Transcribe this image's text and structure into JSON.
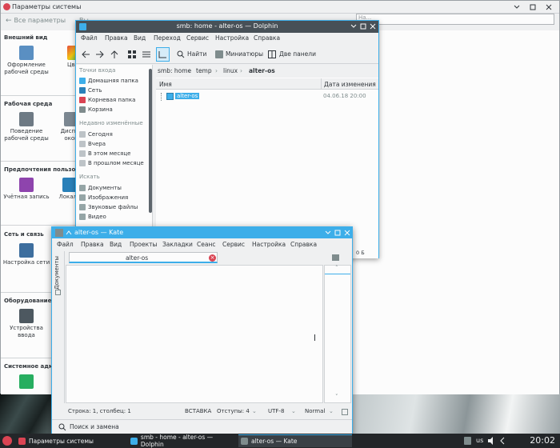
{
  "system_settings": {
    "title": "Параметры системы",
    "back_label": "Все параметры",
    "back_suffix": "Вы",
    "search_placeholder": "На...",
    "sections": [
      {
        "heading": "Внешний вид",
        "items": [
          "Оформление рабочей среды",
          "Цвет"
        ]
      },
      {
        "heading": "Рабочая среда",
        "items": [
          "Поведение рабочей среды",
          "Диспет окон"
        ]
      },
      {
        "heading": "Предпочтения пользо",
        "items": [
          "Учётная запись",
          "Локали"
        ]
      },
      {
        "heading": "Сеть и связь",
        "items": [
          "Настройка сети"
        ]
      },
      {
        "heading": "Оборудование",
        "items": [
          "Устройства ввода"
        ]
      },
      {
        "heading": "Системное адм",
        "items": [
          ""
        ]
      }
    ]
  },
  "dolphin": {
    "title": "smb: home - alter-os — Dolphin",
    "menu": [
      "Файл",
      "Правка",
      "Вид",
      "Переход",
      "Сервис",
      "Настройка",
      "Справка"
    ],
    "toolbar": {
      "search": "Найти",
      "thumbnails": "Миниатюры",
      "split": "Две панели"
    },
    "places": {
      "entry_points_header": "Точки входа",
      "entry_points": [
        "Домашняя папка",
        "Сеть",
        "Корневая папка",
        "Корзина"
      ],
      "recent_header": "Недавно изменённые",
      "recent": [
        "Сегодня",
        "Вчера",
        "В этом месяце",
        "В прошлом месяце"
      ],
      "search_header": "Искать",
      "search": [
        "Документы",
        "Изображения",
        "Звуковые файлы",
        "Видео"
      ]
    },
    "breadcrumbs": [
      "smb: home",
      "temp",
      "linux",
      "alter-os"
    ],
    "columns": {
      "name": "Имя",
      "modified": "Дата изменения"
    },
    "files": [
      {
        "name": "alter-os",
        "date": "04.06.18 20:00"
      }
    ],
    "status": "0 Б"
  },
  "kate": {
    "title": "alter-os — Kate",
    "menu": [
      "Файл",
      "Правка",
      "Вид",
      "Проекты",
      "Закладки",
      "Сеанс",
      "Сервис",
      "Настройка",
      "Справка"
    ],
    "side_label": "Документы",
    "tab_label": "alter-os",
    "status": {
      "position": "Строка: 1, столбец: 1",
      "mode": "ВСТАВКА",
      "indent": "Отступы: 4",
      "encoding": "UTF-8",
      "syntax": "Normal"
    },
    "search_replace": "Поиск и замена"
  },
  "taskbar": {
    "tasks": [
      "Параметры системы",
      "smb - home - alter-os — Dolphin",
      "alter-os — Kate"
    ],
    "lang": "us",
    "clock": "20:02"
  },
  "colors": {
    "accent": "#3daee9",
    "titlebar_dark": "#475057",
    "taskbar": "#232629"
  }
}
